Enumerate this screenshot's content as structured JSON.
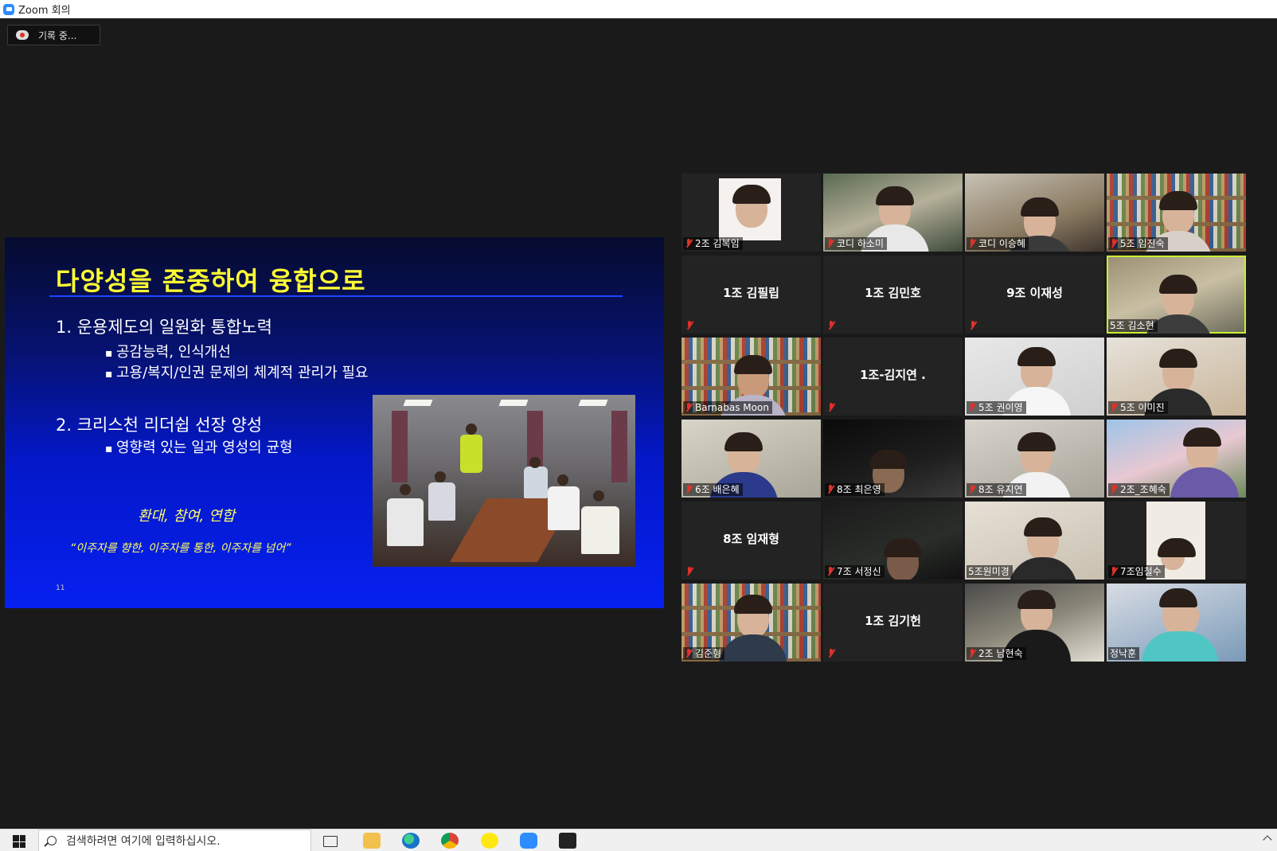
{
  "window": {
    "title": "Zoom 회의"
  },
  "recording": {
    "label": "기록 중..."
  },
  "slide": {
    "title": "다양성을 존중하여 융합으로",
    "point1": "1.  운용제도의 일원화 통합노력",
    "point1_bullets": [
      "공감능력, 인식개선",
      "고용/복지/인권 문제의 체계적 관리가 필요"
    ],
    "point2": "2.  크리스천 리더쉽 선장 양성",
    "point2_bullets": [
      "영향력 있는 일과 영성의 균형"
    ],
    "slogan": "환대, 참여, 연합",
    "quote": "“이주자를 향한, 이주자를 통한, 이주자를 넘어”",
    "page_number": "11"
  },
  "participants": [
    {
      "name": "2조 김복임",
      "video": true,
      "muted": true
    },
    {
      "name": "코디 하소미",
      "video": true,
      "muted": true
    },
    {
      "name": "코디 이승혜",
      "video": true,
      "muted": true
    },
    {
      "name": "5조 임진숙",
      "video": true,
      "muted": true
    },
    {
      "name": "1조 김필립",
      "video": false,
      "muted": true
    },
    {
      "name": "1조 김민호",
      "video": false,
      "muted": true
    },
    {
      "name": "9조 이재성",
      "video": false,
      "muted": true
    },
    {
      "name": "5조 김소현",
      "video": true,
      "muted": false,
      "active": true
    },
    {
      "name": "Barnabas Moon",
      "video": true,
      "muted": true
    },
    {
      "name": "1조-김지연 .",
      "video": false,
      "muted": true
    },
    {
      "name": "5조 권이영",
      "video": true,
      "muted": true
    },
    {
      "name": "5조 이미진",
      "video": true,
      "muted": true
    },
    {
      "name": "6조 배은혜",
      "video": true,
      "muted": true
    },
    {
      "name": "8조 최은영",
      "video": true,
      "muted": true
    },
    {
      "name": "8조 유지연",
      "video": true,
      "muted": true
    },
    {
      "name": "2조_조혜숙",
      "video": true,
      "muted": true
    },
    {
      "name": "8조 임재형",
      "video": false,
      "muted": true
    },
    {
      "name": "7조 서정신",
      "video": true,
      "muted": true
    },
    {
      "name": "5조원미경",
      "video": true,
      "muted": false
    },
    {
      "name": "7조임철수",
      "video": true,
      "muted": true
    },
    {
      "name": "김준형",
      "video": true,
      "muted": true
    },
    {
      "name": "1조 김기헌",
      "video": false,
      "muted": true
    },
    {
      "name": "2조 남현숙",
      "video": true,
      "muted": true
    },
    {
      "name": "정낙훈",
      "video": true,
      "muted": false
    }
  ],
  "taskbar": {
    "search_placeholder": "검색하려면 여기에 입력하십시오.",
    "apps": [
      "task-view-icon",
      "file-explorer-icon",
      "edge-icon",
      "chrome-icon",
      "kakaotalk-icon",
      "zoom-icon",
      "app-icon"
    ]
  }
}
